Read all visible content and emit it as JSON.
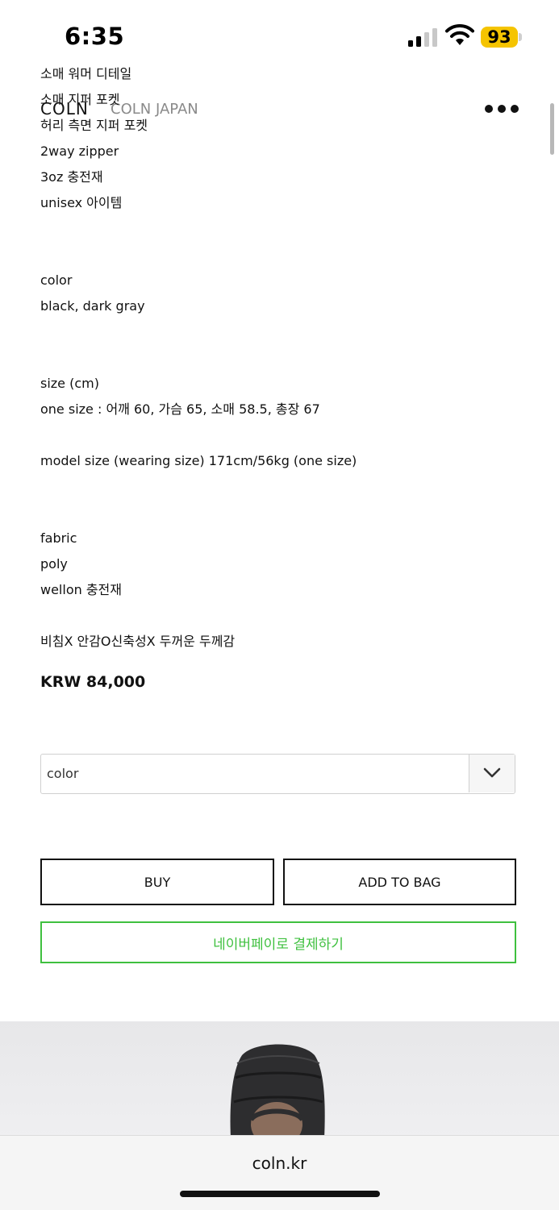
{
  "status_bar": {
    "time": "6:35",
    "battery": "93"
  },
  "header": {
    "logo": "COLN",
    "sub_logo": "COLN JAPAN",
    "more_icon": "more-dots-icon"
  },
  "description": {
    "lines": [
      "소매 워머 디테일",
      "소매 지퍼 포켓",
      "허리 측면 지퍼 포켓",
      "2way zipper",
      "3oz 충전재",
      "unisex 아이템",
      "color",
      "black, dark gray",
      "size (cm)",
      "one size : 어깨 60, 가슴 65, 소매 58.5, 총장 67",
      "model size (wearing size) 171cm/56kg (one size)",
      "fabric",
      "poly",
      "wellon 충전재",
      "비침X 안감O신축성X 두꺼운 두께감"
    ]
  },
  "price": "KRW 84,000",
  "option_select": {
    "value": "color",
    "icon": "chevron-down-icon"
  },
  "actions": {
    "buy": "BUY",
    "add_to_bag": "ADD TO BAG",
    "naver_pay": "네이버페이로 결제하기"
  },
  "colors": {
    "naver_green": "#3fc03f",
    "battery_yellow": "#f5c400"
  },
  "browser": {
    "url": "coln.kr"
  }
}
